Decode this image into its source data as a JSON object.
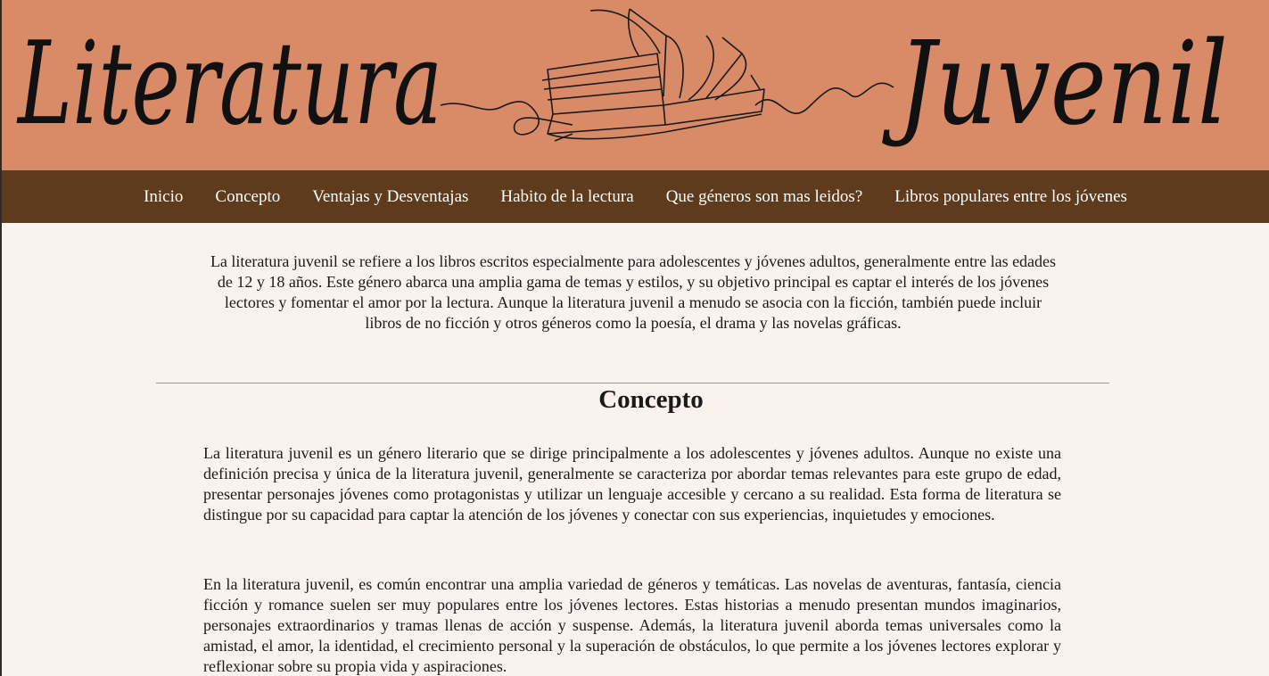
{
  "banner": {
    "word_left": "Literatura",
    "word_right": "Juvenil",
    "background": "#d98b68",
    "decoration": "open-book-line-art-icon"
  },
  "nav": {
    "background": "#5d3b1c",
    "items": [
      {
        "label": "Inicio"
      },
      {
        "label": "Concepto"
      },
      {
        "label": "Ventajas y Desventajas"
      },
      {
        "label": "Habito de la lectura"
      },
      {
        "label": "Que géneros son mas leidos?"
      },
      {
        "label": "Libros populares entre los jóvenes"
      }
    ]
  },
  "intro": {
    "text": "La literatura juvenil se refiere a los libros escritos especialmente para adolescentes y jóvenes adultos, generalmente entre las edades de 12 y 18 años. Este género abarca una amplia gama de temas y estilos, y su objetivo principal es captar el interés de los jóvenes lectores y fomentar el amor por la lectura. Aunque la literatura juvenil a menudo se asocia con la ficción, también puede incluir libros de no ficción y otros géneros como la poesía, el drama y las novelas gráficas."
  },
  "concepto": {
    "title": "Concepto",
    "paragraphs": [
      "La literatura juvenil es un género literario que se dirige principalmente a los adolescentes y jóvenes adultos. Aunque no existe una definición precisa y única de la literatura juvenil, generalmente se caracteriza por abordar temas relevantes para este grupo de edad, presentar personajes jóvenes como protagonistas y utilizar un lenguaje accesible y cercano a su realidad. Esta forma de literatura se distingue por su capacidad para captar la atención de los jóvenes y conectar con sus experiencias, inquietudes y emociones.",
      "En la literatura juvenil, es común encontrar una amplia variedad de géneros y temáticas. Las novelas de aventuras, fantasía, ciencia ficción y romance suelen ser muy populares entre los jóvenes lectores. Estas historias a menudo presentan mundos imaginarios, personajes extraordinarios y tramas llenas de acción y suspense. Además, la literatura juvenil aborda temas universales como la amistad, el amor, la identidad, el crecimiento personal y la superación de obstáculos, lo que permite a los jóvenes lectores explorar y reflexionar sobre su propia vida y aspiraciones."
    ]
  }
}
